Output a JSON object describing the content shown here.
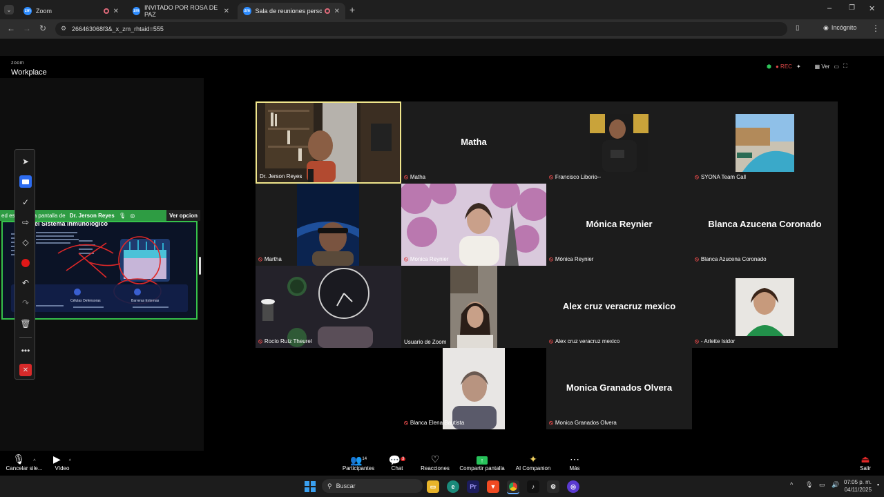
{
  "browser": {
    "tabs": [
      {
        "label": "Zoom",
        "active": false
      },
      {
        "label": "INVITADO POR ROSA DE PAZ",
        "active": false
      },
      {
        "label": "Sala de reuniones personal",
        "active": true
      }
    ],
    "url": "266463068f3&_x_zm_rhtaid=555",
    "incognito_label": "Incógnito"
  },
  "zoom": {
    "brand_small": "zoom",
    "brand_label": "Workplace",
    "rec_label": "REC",
    "view_label": "Ver",
    "share_banner": {
      "text_prefix": "ed es",
      "text_suffix": "do la pantalla de",
      "presenter": "Dr. Jerson Reyes",
      "view_options": "Ver opcion"
    },
    "shared_slide": {
      "heading": "el Sistema Inmunologico",
      "item1": "Células Defensoras",
      "item2": "Barreras Externas"
    },
    "participants": [
      {
        "name": "Dr. Jerson Reyes",
        "muted": false,
        "big": false,
        "video": true
      },
      {
        "name": "Matha",
        "muted": true,
        "big": true,
        "video": false
      },
      {
        "name": "Francisco Liborio--",
        "muted": true,
        "big": false,
        "video": true
      },
      {
        "name": "SYONA Team Call",
        "muted": true,
        "big": false,
        "video": true
      },
      {
        "name": "Martha",
        "muted": true,
        "big": false,
        "video": true
      },
      {
        "name": "Monica Reynier",
        "muted": true,
        "big": false,
        "video": true
      },
      {
        "name": "Mónica Reynier",
        "muted": true,
        "big": true,
        "video": false
      },
      {
        "name": "Blanca Azucena Coronado",
        "muted": true,
        "big": true,
        "video": false
      },
      {
        "name": "Rocío Ruíz Theurel",
        "muted": true,
        "big": false,
        "video": true
      },
      {
        "name": "Usuario de Zoom",
        "muted": false,
        "big": false,
        "video": true
      },
      {
        "name": "Alex cruz veracruz mexico",
        "muted": true,
        "big": true,
        "video": false
      },
      {
        "name": "- Arlette Isidor",
        "muted": true,
        "big": false,
        "video": true
      },
      {
        "name": "Blanca Elena Bautista",
        "muted": true,
        "big": false,
        "video": true
      },
      {
        "name": "Monica Granados Olvera",
        "muted": true,
        "big": true,
        "video": false
      }
    ],
    "toolbar": {
      "audio": "Cancelar sile...",
      "video": "Vídeo",
      "participants": "Participantes",
      "participants_count": "14",
      "chat": "Chat",
      "chat_badge": "3",
      "reactions": "Reacciones",
      "share": "Compartir pantalla",
      "ai": "AI Companion",
      "more": "Más",
      "leave": "Salir"
    }
  },
  "taskbar": {
    "search_placeholder": "Buscar",
    "time": "07:05 p. m.",
    "date": "04/11/2025"
  },
  "colors": {
    "active_speaker": "#f0e68c",
    "share_border": "#36c24b",
    "mute": "#e04848",
    "leave": "#e02828"
  }
}
